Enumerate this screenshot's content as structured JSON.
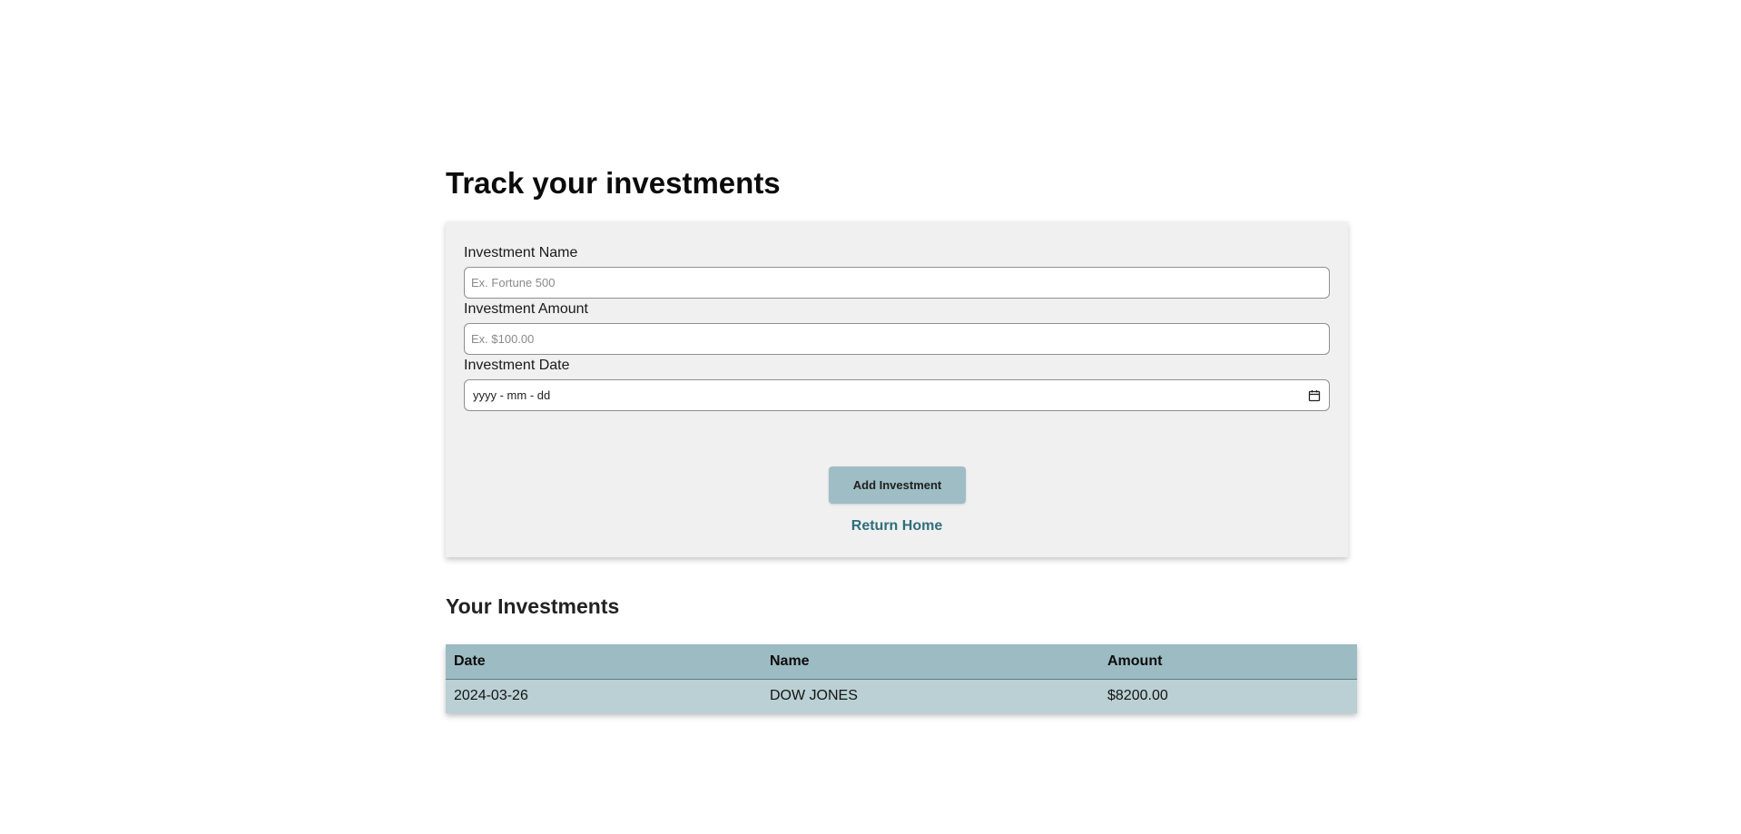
{
  "page": {
    "title": "Track your investments"
  },
  "form": {
    "name_label": "Investment Name",
    "name_placeholder": "Ex. Fortune 500",
    "amount_label": "Investment Amount",
    "amount_placeholder": "Ex. $100.00",
    "date_label": "Investment Date",
    "date_placeholder": "yyyy - mm - dd",
    "date_icon": "calendar-icon",
    "submit_label": "Add Investment",
    "return_label": "Return Home"
  },
  "investments": {
    "title": "Your Investments",
    "columns": [
      "Date",
      "Name",
      "Amount"
    ],
    "rows": [
      [
        "2024-03-26",
        "DOW JONES",
        "$8200.00"
      ]
    ]
  },
  "colors": {
    "button_bg": "#9ebdc4",
    "link": "#2f6e7a",
    "table_header_bg": "#9dbbc3",
    "table_row_bg": "#bad0d4",
    "form_bg": "#f0f0f0"
  }
}
